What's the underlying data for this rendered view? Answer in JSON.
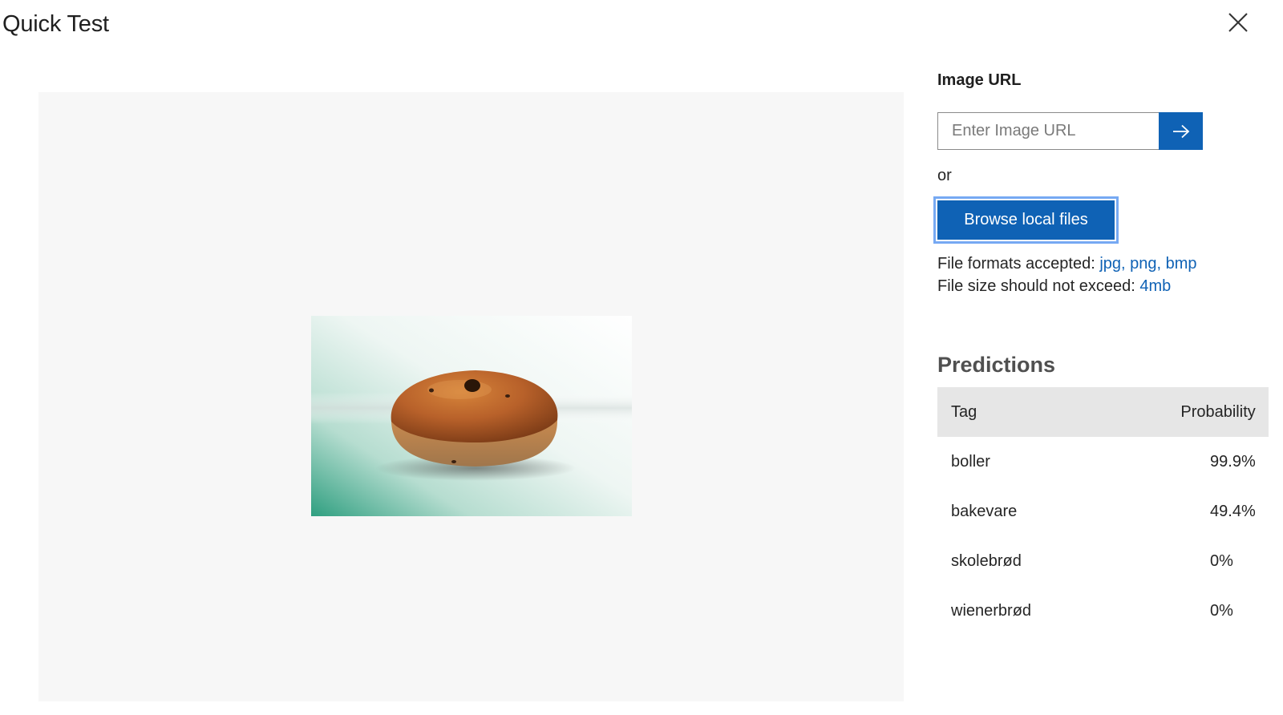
{
  "dialog": {
    "title": "Quick Test",
    "close_icon": "close-icon"
  },
  "image_url": {
    "label": "Image URL",
    "placeholder": "Enter Image URL",
    "value": "",
    "submit_icon": "arrow-right-icon"
  },
  "or_text": "or",
  "browse_button": "Browse local files",
  "file_info": {
    "formats_prefix": "File formats accepted: ",
    "formats": "jpg, png, bmp",
    "size_prefix": "File size should not exceed: ",
    "size": "4mb"
  },
  "preview": {
    "image_subject": "bun-photo"
  },
  "predictions": {
    "title": "Predictions",
    "columns": [
      "Tag",
      "Probability"
    ],
    "rows": [
      {
        "tag": "boller",
        "probability": "99.9%"
      },
      {
        "tag": "bakevare",
        "probability": "49.4%"
      },
      {
        "tag": "skolebrød",
        "probability": "0%"
      },
      {
        "tag": "wienerbrød",
        "probability": "0%"
      }
    ]
  },
  "colors": {
    "accent": "#0f62b5",
    "preview_bg": "#f7f7f7",
    "table_header_bg": "#e6e6e6",
    "focus_ring": "#76a9f3"
  }
}
